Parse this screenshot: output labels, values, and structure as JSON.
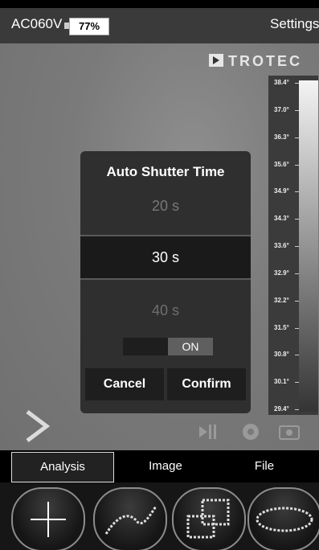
{
  "statusbar": {
    "device": "AC060V",
    "battery": "77%",
    "settings_label": "Settings"
  },
  "brand": "TROTEC",
  "scale": {
    "labels": [
      "38.4°",
      "37.0°",
      "36.3°",
      "35.6°",
      "34.9°",
      "34.3°",
      "33.6°",
      "32.9°",
      "32.2°",
      "31.5°",
      "30.8°",
      "30.1°",
      "29.4°"
    ]
  },
  "dialog": {
    "title": "Auto Shutter Time",
    "prev_option": "20 s",
    "selected_option": "30 s",
    "next_option": "40 s",
    "toggle_label": "ON",
    "cancel_label": "Cancel",
    "confirm_label": "Confirm"
  },
  "tabs": [
    {
      "label": "Analysis"
    },
    {
      "label": "Image"
    },
    {
      "label": "File"
    }
  ],
  "tools": [
    {
      "icon": "crosshair-icon"
    },
    {
      "icon": "line-profile-icon"
    },
    {
      "icon": "area-box-icon"
    },
    {
      "icon": "ellipse-area-icon"
    }
  ]
}
